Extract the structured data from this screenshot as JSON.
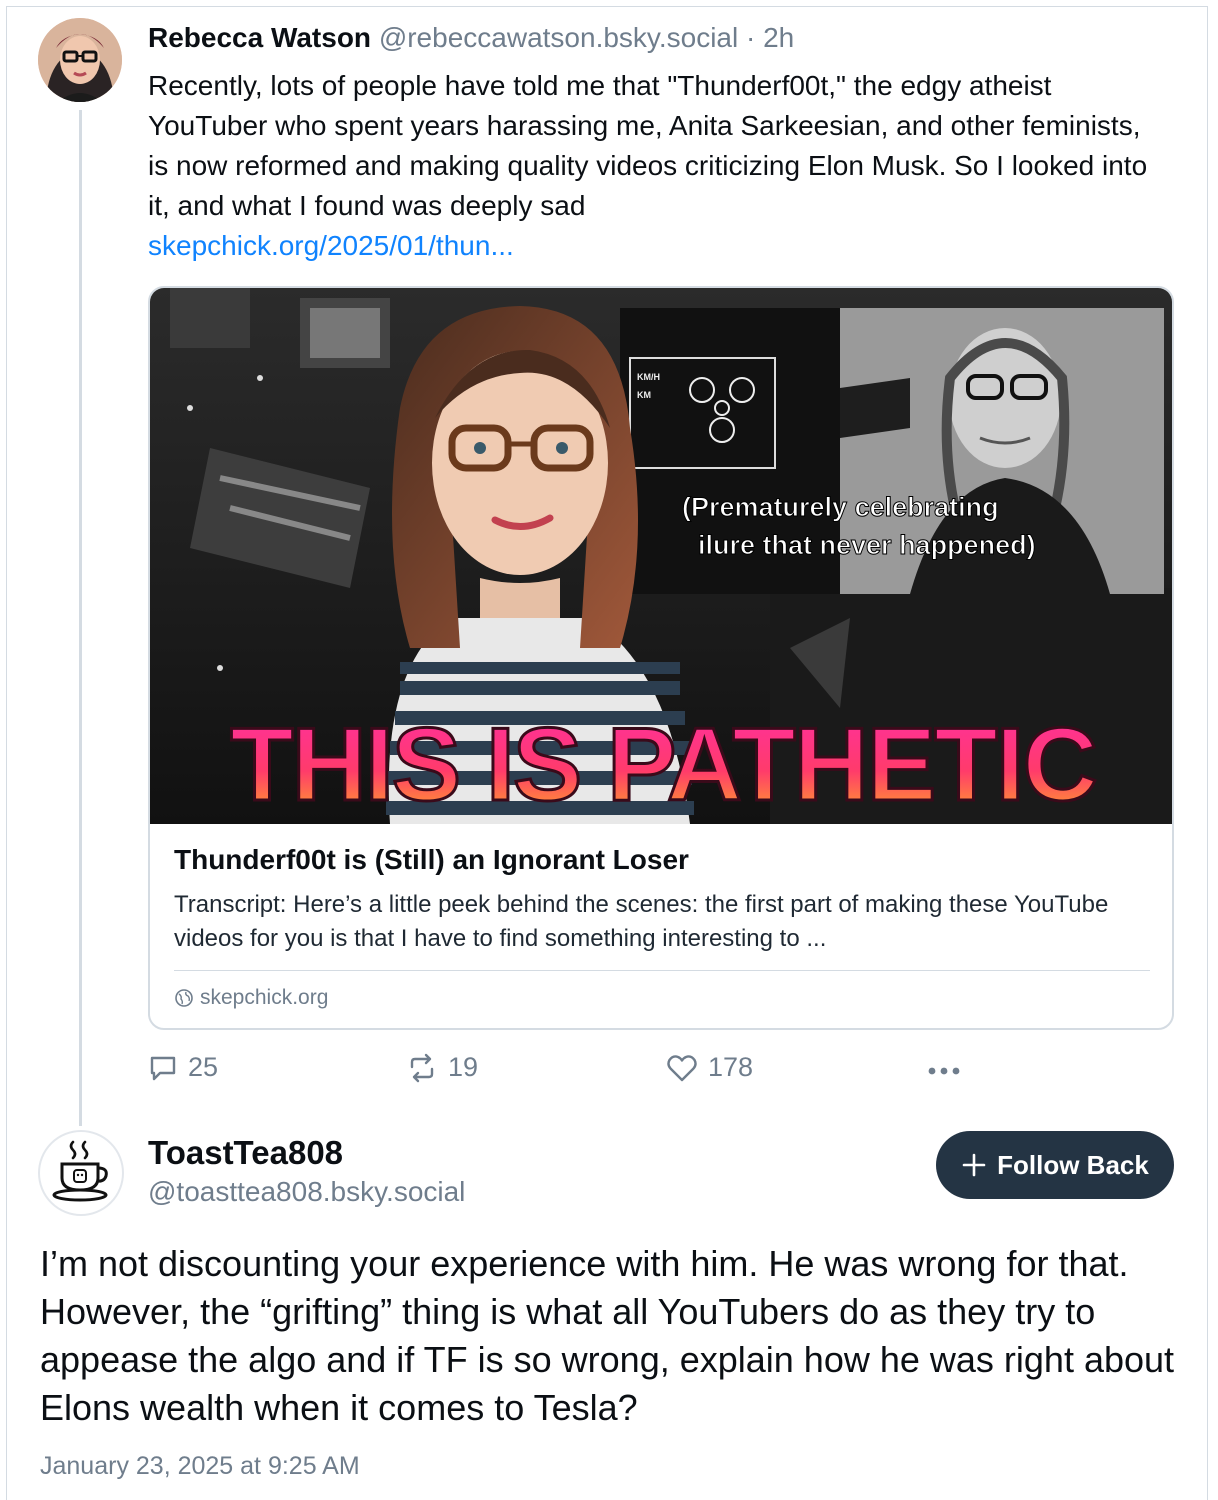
{
  "parent_post": {
    "author_name": "Rebecca Watson",
    "author_handle": "@rebeccawatson.bsky.social",
    "time_sep": " · ",
    "time": "2h",
    "text": "Recently, lots of people have told me that \"Thunderf00t,\" the edgy atheist YouTuber who spent years harassing me, Anita Sarkeesian, and other feminists, is now reformed and making quality videos criticizing Elon Musk. So I looked into it, and what I found was deeply sad",
    "link_text": "skepchick.org/2025/01/thun...",
    "embed": {
      "image_caption_line1": "(Prematurely celebrating",
      "image_caption_line2": "ilure that never happened)",
      "image_headline": "THIS IS PATHETIC",
      "image_small_label1": "KM/H",
      "image_small_label2": "KM",
      "title": "Thunderf00t is (Still) an Ignorant Loser",
      "description": "Transcript: Here’s a little peek behind the scenes: the first part of making these YouTube videos for you is that I have to find something interesting to ...",
      "domain": "skepchick.org",
      "domain_icon": "globe-icon"
    },
    "actions": {
      "replies": "25",
      "reposts": "19",
      "likes": "178"
    }
  },
  "reply_post": {
    "author_name": "ToastTea808",
    "author_handle": "@toasttea808.bsky.social",
    "follow_label": "Follow Back",
    "text": "I’m not discounting your experience with him.  He was wrong for that.  However,  the “grifting” thing is what all YouTubers do as they try to appease the algo and if TF is so wrong, explain how he was right about Elons wealth when it comes to Tesla?",
    "timestamp": "January 23, 2025 at 9:25 AM"
  },
  "colors": {
    "link": "#1083fe",
    "muted": "#6f7d8c",
    "follow_button_bg": "#243444",
    "headline_gradient_top": "#ff2fa0",
    "headline_gradient_bottom": "#ffb020"
  }
}
